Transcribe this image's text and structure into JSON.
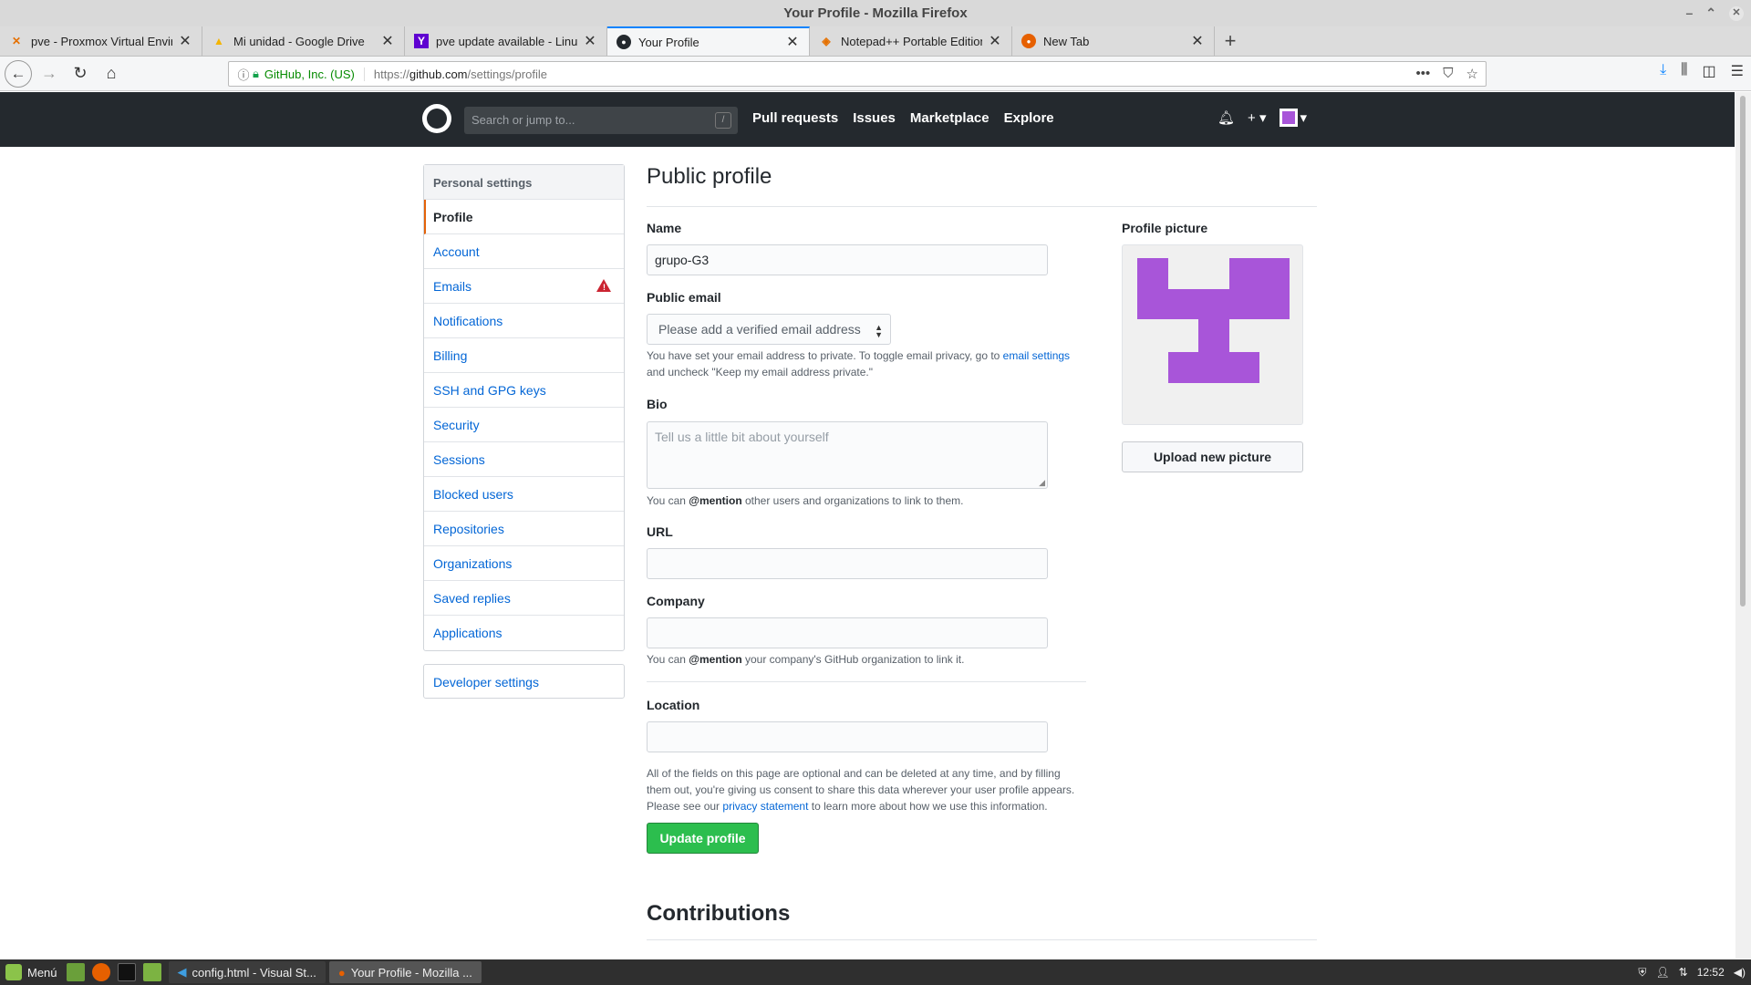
{
  "window": {
    "title": "Your Profile - Mozilla Firefox",
    "controls": [
      "minimize-icon",
      "maximize-icon",
      "close-icon"
    ]
  },
  "tabs": [
    {
      "title": "pve - Proxmox Virtual Environ",
      "icon": "proxmox-icon",
      "active": false
    },
    {
      "title": "Mi unidad - Google Drive",
      "icon": "google-drive-icon",
      "active": false
    },
    {
      "title": "pve update available - LinuxM",
      "icon": "yahoo-icon",
      "active": false
    },
    {
      "title": "Your Profile",
      "icon": "github-icon",
      "active": true
    },
    {
      "title": "Notepad++ Portable Edition d",
      "icon": "notepad-icon",
      "active": false
    },
    {
      "title": "New Tab",
      "icon": "firefox-icon",
      "active": false
    }
  ],
  "urlbar": {
    "company": "GitHub, Inc. (US)",
    "url_prefix": "https://",
    "url_host": "github.com",
    "url_path": "/settings/profile"
  },
  "github_header": {
    "search_placeholder": "Search or jump to...",
    "search_shortcut": "/",
    "nav": [
      "Pull requests",
      "Issues",
      "Marketplace",
      "Explore"
    ],
    "plus_label": "+"
  },
  "sidebar": {
    "heading": "Personal settings",
    "items": [
      {
        "label": "Profile",
        "selected": true
      },
      {
        "label": "Account"
      },
      {
        "label": "Emails",
        "warning": true
      },
      {
        "label": "Notifications"
      },
      {
        "label": "Billing"
      },
      {
        "label": "SSH and GPG keys"
      },
      {
        "label": "Security"
      },
      {
        "label": "Sessions"
      },
      {
        "label": "Blocked users"
      },
      {
        "label": "Repositories"
      },
      {
        "label": "Organizations"
      },
      {
        "label": "Saved replies"
      },
      {
        "label": "Applications"
      }
    ],
    "developer_settings": "Developer settings"
  },
  "profile": {
    "title": "Public profile",
    "name_label": "Name",
    "name_value": "grupo-G3",
    "email_label": "Public email",
    "email_select": "Please add a verified email address",
    "email_hint_1": "You have set your email address to private. To toggle email privacy, go to",
    "email_hint_link": "email settings",
    "email_hint_2": "and uncheck \"Keep my email address private.\"",
    "bio_label": "Bio",
    "bio_placeholder": "Tell us a little bit about yourself",
    "bio_hint_pre": "You can",
    "bio_hint_mention": "@mention",
    "bio_hint_post": "other users and organizations to link to them.",
    "url_label": "URL",
    "company_label": "Company",
    "company_hint_pre": "You can",
    "company_hint_mention": "@mention",
    "company_hint_post": "your company's GitHub organization to link it.",
    "location_label": "Location",
    "consent_1": "All of the fields on this page are optional and can be deleted at any time, and by filling",
    "consent_2": "them out, you're giving us consent to share this data wherever your user profile appears.",
    "consent_3": "Please see our",
    "consent_link": "privacy statement",
    "consent_4": "to learn more about how we use this information.",
    "update_button": "Update profile",
    "picture_label": "Profile picture",
    "upload_button": "Upload new picture",
    "avatar_color": "#a855d9",
    "contributions_title": "Contributions"
  },
  "taskbar": {
    "menu_label": "Menú",
    "windows": [
      {
        "label": "config.html - Visual St...",
        "active": false
      },
      {
        "label": "Your Profile - Mozilla ...",
        "active": true
      }
    ],
    "clock": "12:52"
  }
}
